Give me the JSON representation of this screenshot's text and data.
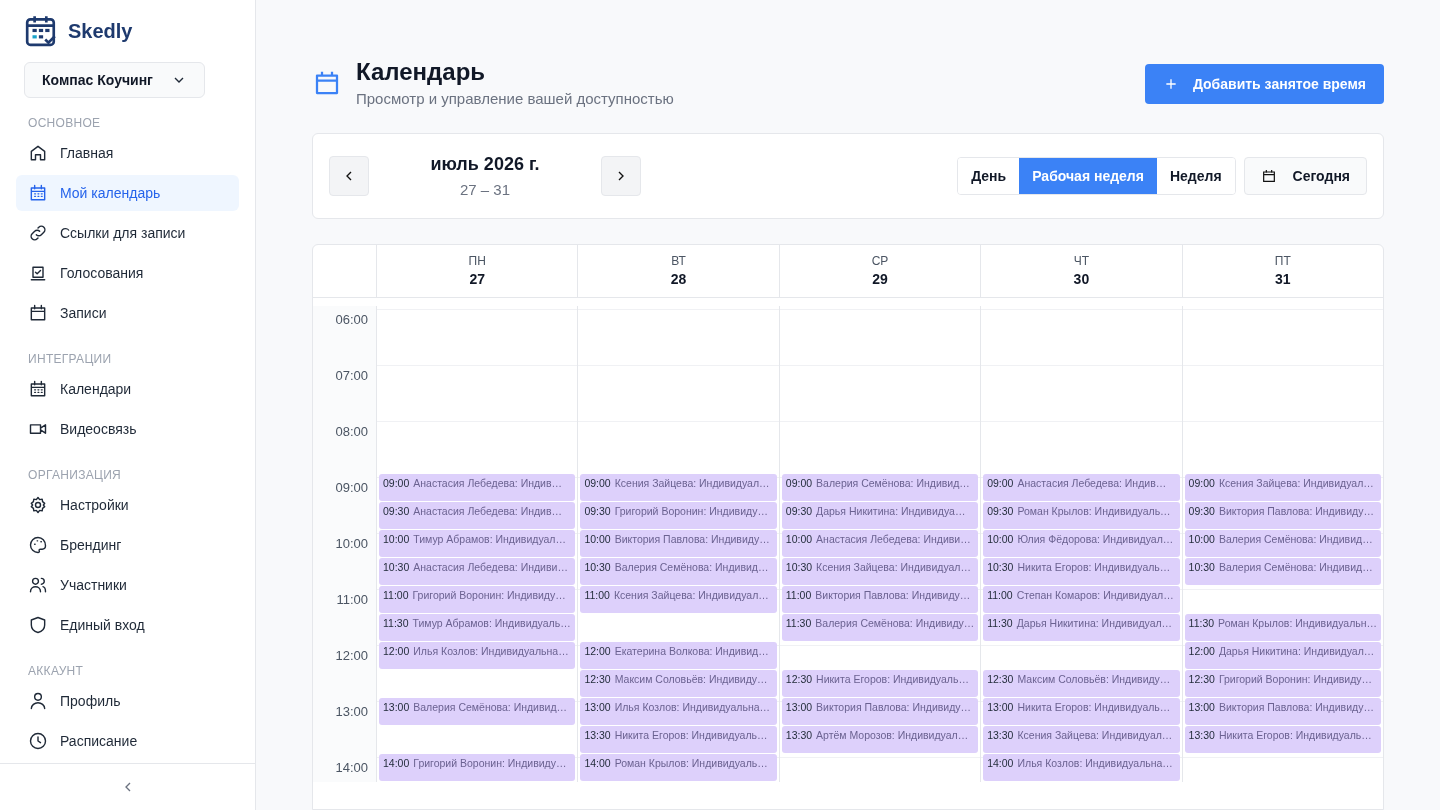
{
  "brand": {
    "name": "Skedly"
  },
  "workspace": {
    "label": "Компас Коучинг"
  },
  "sidebar": {
    "sections": [
      {
        "title": "ОСНОВНОЕ",
        "items": [
          {
            "label": "Главная",
            "selected": false
          },
          {
            "label": "Мой календарь",
            "selected": true
          },
          {
            "label": "Ссылки для записи",
            "selected": false
          },
          {
            "label": "Голосования",
            "selected": false
          },
          {
            "label": "Записи",
            "selected": false
          }
        ]
      },
      {
        "title": "ИНТЕГРАЦИИ",
        "items": [
          {
            "label": "Календари",
            "selected": false
          },
          {
            "label": "Видеосвязь",
            "selected": false
          }
        ]
      },
      {
        "title": "ОРГАНИЗАЦИЯ",
        "items": [
          {
            "label": "Настройки",
            "selected": false
          },
          {
            "label": "Брендинг",
            "selected": false
          },
          {
            "label": "Участники",
            "selected": false
          },
          {
            "label": "Единый вход",
            "selected": false
          }
        ]
      },
      {
        "title": "АККАУНТ",
        "items": [
          {
            "label": "Профиль",
            "selected": false
          },
          {
            "label": "Расписание",
            "selected": false
          }
        ]
      }
    ]
  },
  "page": {
    "title": "Календарь",
    "subtitle": "Просмотр и управление вашей доступностью",
    "add_button": "Добавить занятое время"
  },
  "toolbar": {
    "month": "июль 2026 г.",
    "range": "27 – 31",
    "views": [
      {
        "label": "День",
        "selected": false
      },
      {
        "label": "Рабочая неделя",
        "selected": true
      },
      {
        "label": "Неделя",
        "selected": false
      }
    ],
    "today": "Сегодня"
  },
  "calendar": {
    "hours": [
      "06:00",
      "07:00",
      "08:00",
      "09:00",
      "10:00",
      "11:00",
      "12:00",
      "13:00",
      "14:00"
    ],
    "days": [
      {
        "weekday": "ПН",
        "date": "27",
        "events": [
          {
            "time": "09:00",
            "title": "Анастасия Лебедева: Индив…"
          },
          {
            "time": "09:30",
            "title": "Анастасия Лебедева: Индив…"
          },
          {
            "time": "10:00",
            "title": "Тимур Абрамов: Индивидуал…"
          },
          {
            "time": "10:30",
            "title": "Анастасия Лебедева: Индиви…"
          },
          {
            "time": "11:00",
            "title": "Григорий Воронин: Индивиду…"
          },
          {
            "time": "11:30",
            "title": "Тимур Абрамов: Индивидуаль…"
          },
          {
            "time": "12:00",
            "title": "Илья Козлов: Индивидуальна…"
          },
          {
            "time": "13:00",
            "title": "Валерия Семёнова: Индивид…"
          },
          {
            "time": "14:00",
            "title": "Григорий Воронин: Индивиду…"
          }
        ]
      },
      {
        "weekday": "ВТ",
        "date": "28",
        "events": [
          {
            "time": "09:00",
            "title": "Ксения Зайцева: Индивидуал…"
          },
          {
            "time": "09:30",
            "title": "Григорий Воронин: Индивиду…"
          },
          {
            "time": "10:00",
            "title": "Виктория Павлова: Индивиду…"
          },
          {
            "time": "10:30",
            "title": "Валерия Семёнова: Индивид…"
          },
          {
            "time": "11:00",
            "title": "Ксения Зайцева: Индивидуал…"
          },
          {
            "time": "12:00",
            "title": "Екатерина Волкова: Индивид…"
          },
          {
            "time": "12:30",
            "title": "Максим Соловьёв: Индивиду…"
          },
          {
            "time": "13:00",
            "title": "Илья Козлов: Индивидуальна…"
          },
          {
            "time": "13:30",
            "title": "Никита Егоров: Индивидуаль…"
          },
          {
            "time": "14:00",
            "title": "Роман Крылов: Индивидуаль…"
          }
        ]
      },
      {
        "weekday": "СР",
        "date": "29",
        "events": [
          {
            "time": "09:00",
            "title": "Валерия Семёнова: Индивид…"
          },
          {
            "time": "09:30",
            "title": "Дарья Никитина: Индивидуа…"
          },
          {
            "time": "10:00",
            "title": "Анастасия Лебедева: Индиви…"
          },
          {
            "time": "10:30",
            "title": "Ксения Зайцева: Индивидуал…"
          },
          {
            "time": "11:00",
            "title": "Виктория Павлова: Индивиду…"
          },
          {
            "time": "11:30",
            "title": "Валерия Семёнова: Индивиду…"
          },
          {
            "time": "12:30",
            "title": "Никита Егоров: Индивидуаль…"
          },
          {
            "time": "13:00",
            "title": "Виктория Павлова: Индивиду…"
          },
          {
            "time": "13:30",
            "title": "Артём Морозов: Индивидуал…"
          }
        ]
      },
      {
        "weekday": "ЧТ",
        "date": "30",
        "events": [
          {
            "time": "09:00",
            "title": "Анастасия Лебедева: Индив…"
          },
          {
            "time": "09:30",
            "title": "Роман Крылов: Индивидуаль…"
          },
          {
            "time": "10:00",
            "title": "Юлия Фёдорова: Индивидуал…"
          },
          {
            "time": "10:30",
            "title": "Никита Егоров: Индивидуаль…"
          },
          {
            "time": "11:00",
            "title": "Степан Комаров: Индивидуал…"
          },
          {
            "time": "11:30",
            "title": "Дарья Никитина: Индивидуал…"
          },
          {
            "time": "12:30",
            "title": "Максим Соловьёв: Индивиду…"
          },
          {
            "time": "13:00",
            "title": "Никита Егоров: Индивидуаль…"
          },
          {
            "time": "13:30",
            "title": "Ксения Зайцева: Индивидуал…"
          },
          {
            "time": "14:00",
            "title": "Илья Козлов: Индивидуальна…"
          }
        ]
      },
      {
        "weekday": "ПТ",
        "date": "31",
        "events": [
          {
            "time": "09:00",
            "title": "Ксения Зайцева: Индивидуал…"
          },
          {
            "time": "09:30",
            "title": "Виктория Павлова: Индивиду…"
          },
          {
            "time": "10:00",
            "title": "Валерия Семёнова: Индивид…"
          },
          {
            "time": "10:30",
            "title": "Валерия Семёнова: Индивид…"
          },
          {
            "time": "11:30",
            "title": "Роман Крылов: Индивидуальн…"
          },
          {
            "time": "12:00",
            "title": "Дарья Никитина: Индивидуал…"
          },
          {
            "time": "12:30",
            "title": "Григорий Воронин: Индивиду…"
          },
          {
            "time": "13:00",
            "title": "Виктория Павлова: Индивиду…"
          },
          {
            "time": "13:30",
            "title": "Никита Егоров: Индивидуаль…"
          }
        ]
      }
    ]
  }
}
